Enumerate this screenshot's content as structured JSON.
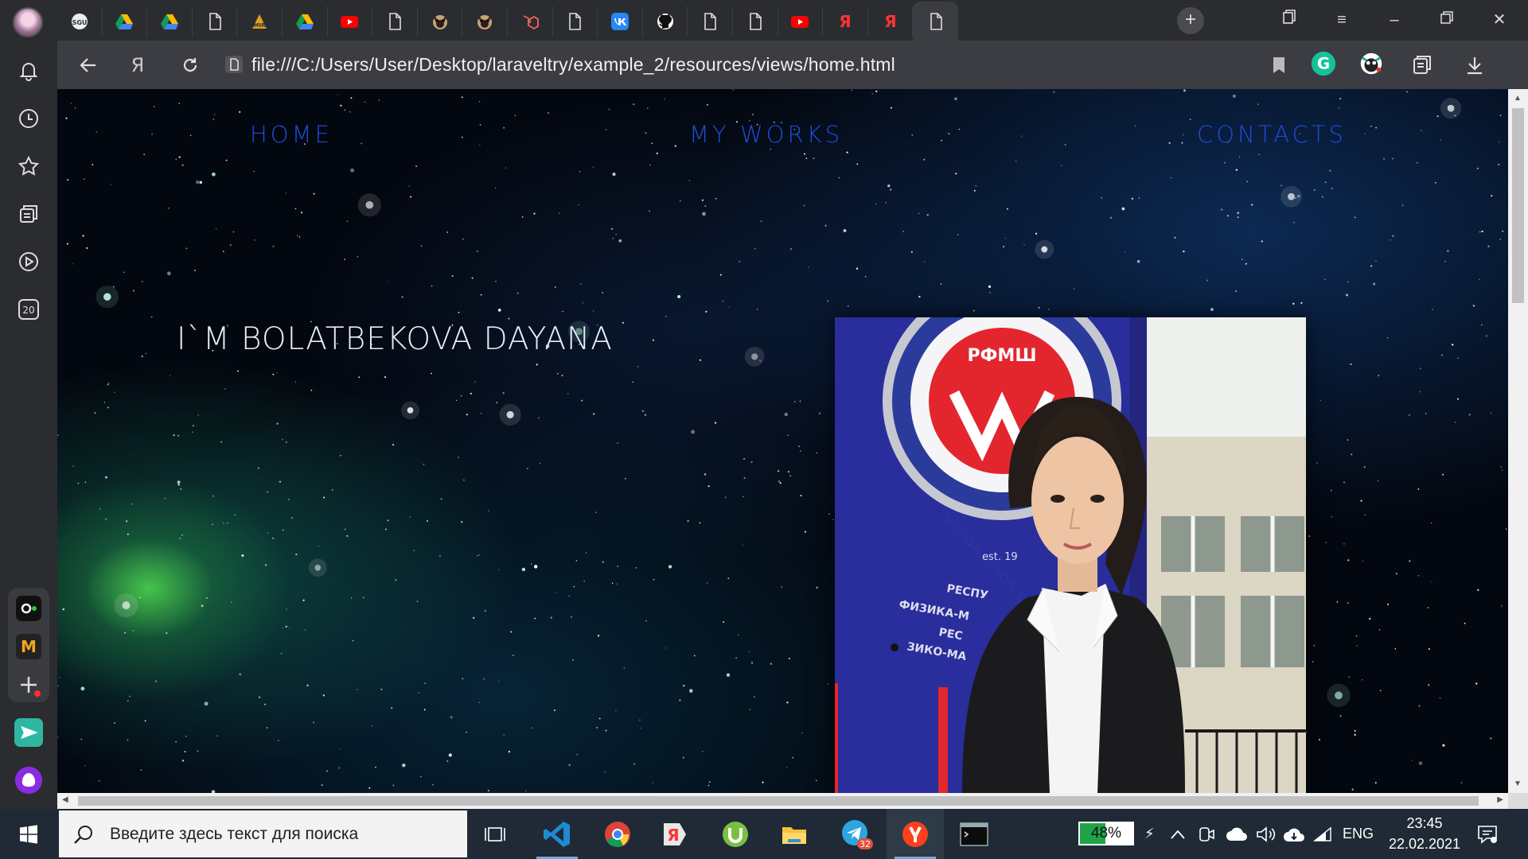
{
  "browser": {
    "tabs": [
      {
        "icon": "sgu-icon",
        "color": "#e8e8e8"
      },
      {
        "icon": "google-drive-icon",
        "color": "#34a853"
      },
      {
        "icon": "google-drive-icon",
        "color": "#34a853"
      },
      {
        "icon": "page-icon",
        "color": "#dddddd"
      },
      {
        "icon": "mir-icon",
        "color": "#e0a020"
      },
      {
        "icon": "google-drive-icon",
        "color": "#34a853"
      },
      {
        "icon": "youtube-icon",
        "color": "#ff0000"
      },
      {
        "icon": "page-icon",
        "color": "#dddddd"
      },
      {
        "icon": "pug-icon",
        "color": "#c8a27a"
      },
      {
        "icon": "pug-icon",
        "color": "#c8a27a"
      },
      {
        "icon": "laravel-icon",
        "color": "#f4645f"
      },
      {
        "icon": "page-icon",
        "color": "#dddddd"
      },
      {
        "icon": "vk-icon",
        "color": "#2787f5"
      },
      {
        "icon": "github-icon",
        "color": "#ffffff"
      },
      {
        "icon": "page-icon",
        "color": "#dddddd"
      },
      {
        "icon": "page-icon",
        "color": "#dddddd"
      },
      {
        "icon": "youtube-icon",
        "color": "#ff0000"
      },
      {
        "icon": "yandex-icon",
        "color": "#ff3333"
      },
      {
        "icon": "yandex-icon",
        "color": "#ff3333"
      },
      {
        "icon": "page-icon",
        "color": "#dddddd",
        "active": true
      }
    ],
    "yandex_letter": "Я",
    "url": "file:///C:/Users/User/Desktop/laraveltry/example_2/resources/views/home.html",
    "extensions": [
      "grammarly-icon",
      "pug-extension-icon"
    ],
    "sidebar_badge": "20"
  },
  "page": {
    "nav": {
      "home": "HOME",
      "works": "MY WORKS",
      "contacts": "CONTACTS",
      "color": "#1f4cd6"
    },
    "hero": "I`M BOLATBEKOVA DAYANA",
    "photo": {
      "sign_text": "РФМШ",
      "ring_text": "NATIONAL SCHOOL OF PH",
      "est_text": "est. 19",
      "plate_line1": "РЕСПУ",
      "plate_line2": "ФИЗИКА-М",
      "plate_line3": "РЕС",
      "plate_line4": "ЗИКО-МА"
    }
  },
  "taskbar": {
    "search_placeholder": "Введите здесь текст для поиска",
    "telegram_badge": "32",
    "battery": "48%",
    "battery_level": 0.48,
    "language": "ENG",
    "time": "23:45",
    "date": "22.02.2021"
  }
}
